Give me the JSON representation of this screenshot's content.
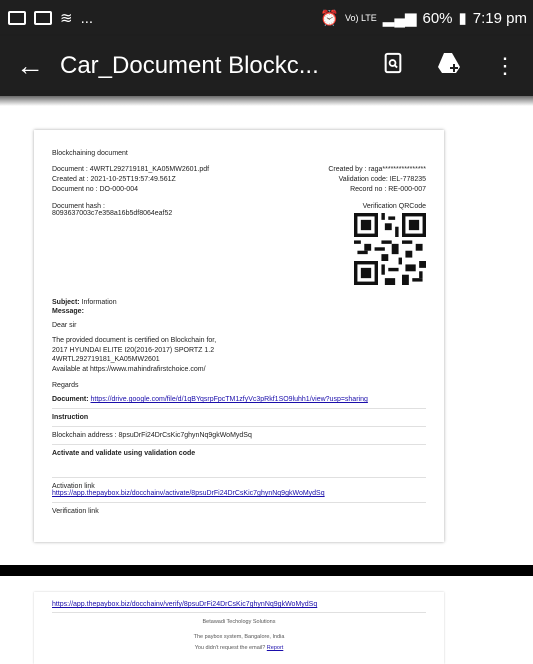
{
  "status_bar": {
    "signal_text": "Vo) LTE",
    "network": "LTE",
    "battery": "60%",
    "time": "7:19 pm",
    "dots": "..."
  },
  "app_bar": {
    "title": "Car_Document Blockc...",
    "back_icon": "arrow-left-icon",
    "search_icon": "doc-search-icon",
    "drive_icon": "drive-add-icon",
    "more_icon": "more-vert-icon"
  },
  "doc": {
    "heading": "Blockchaining document",
    "document_label": "Document : 4WRTL292719181_KA05MW2601.pdf",
    "created_at": "Created at : 2021-10-25T19:57:49.561Z",
    "document_no": "Document no : DO-000-004",
    "created_by": "Created by : raga****************",
    "validation_code": "Validation code: IEL-778235",
    "record_no": "Record no : RE-000-007",
    "hash_label": "Document hash :",
    "hash_value": "8093637003c7e358a16b5df8064eaf52",
    "qr_label": "Verification QRCode",
    "subject_label": "Subject:",
    "subject_value": "Information",
    "message_label": "Message:",
    "greeting": "Dear sir",
    "body_line1": "The provided document is certified on Blockchain for,",
    "body_line2": "2017 HYUNDAI ELITE I20(2016-2017) SPORTZ 1.2",
    "body_line3": "4WRTL292719181_KA05MW2601",
    "body_line4": "Available at https://www.mahindrafirstchoice.com/",
    "regards": "Regards",
    "document_link_label": "Document:",
    "document_link": "https://drive.google.com/file/d/1qBYqsrpFpcTM1zfyVc3pRkf1SO9luhh1/view?usp=sharing",
    "instruction_label": "Instruction",
    "blockchain_address": "Blockchain address : 8psuDrFi24DrCsKic7ghynNq9gkWoMydSq",
    "activate_label": "Activate and validate using validation code",
    "activation_link_label": "Activation link",
    "activation_link": "https://app.thepaybox.biz/docchainv/activate/8psuDrFi24DrCsKic7ghynNq9gkWoMydSq",
    "verification_link_label": "Verification link"
  },
  "doc2": {
    "verify_link": "https://app.thepaybox.biz/docchainv/verify/8psuDrFi24DrCsKic7ghynNq9gkWoMydSq",
    "company": "Betawadi Techology Solutions",
    "system_line": "The paybox system, Bangalore, India",
    "request_text": "You didn't request the email?",
    "report_link": "Report"
  }
}
